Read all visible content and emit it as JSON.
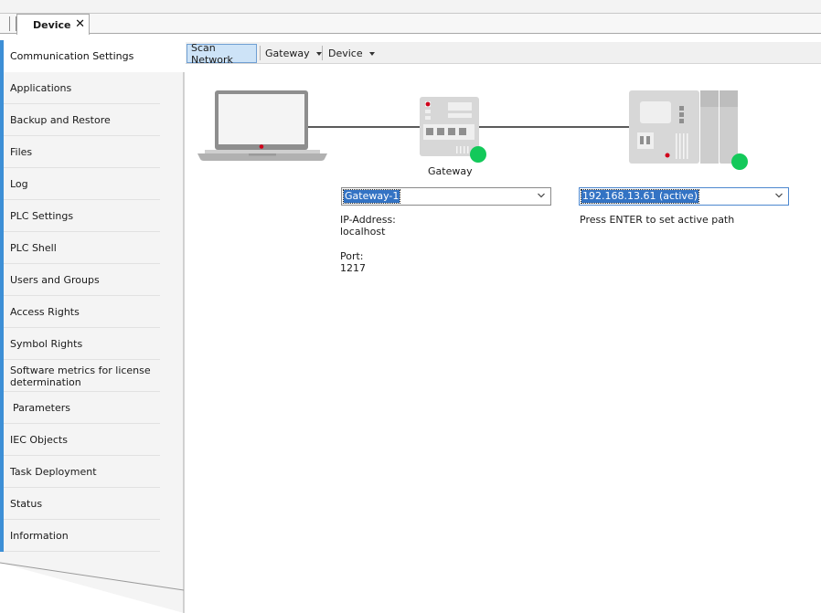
{
  "tab": {
    "title": "Device",
    "close_glyph": "✕",
    "close_icon": "close-icon"
  },
  "nav": {
    "items": [
      {
        "label": "Communication Settings",
        "active": true
      },
      {
        "label": "Applications"
      },
      {
        "label": "Backup and Restore"
      },
      {
        "label": "Files"
      },
      {
        "label": "Log"
      },
      {
        "label": "PLC Settings"
      },
      {
        "label": "PLC Shell"
      },
      {
        "label": "Users and Groups"
      },
      {
        "label": "Access Rights"
      },
      {
        "label": "Symbol Rights"
      },
      {
        "label": "Software metrics for license determination"
      },
      {
        "label": " Parameters"
      },
      {
        "label": "IEC Objects"
      },
      {
        "label": "Task Deployment"
      },
      {
        "label": "Status"
      },
      {
        "label": "Information"
      }
    ]
  },
  "toolbar": {
    "scan_network": "Scan Network",
    "gateway": "Gateway",
    "device": "Device"
  },
  "diagram": {
    "gateway_caption": "Gateway",
    "gateway_select": {
      "value": "Gateway-1"
    },
    "gateway_info": {
      "ip_label": "IP-Address:",
      "ip_value": "localhost",
      "port_label": "Port:",
      "port_value": "1217"
    },
    "device_select": {
      "value": "192.168.13.61 (active)"
    },
    "device_hint": "Press ENTER to set active path",
    "status_color": "#13c95a",
    "accent_color": "#3d8fd6"
  }
}
